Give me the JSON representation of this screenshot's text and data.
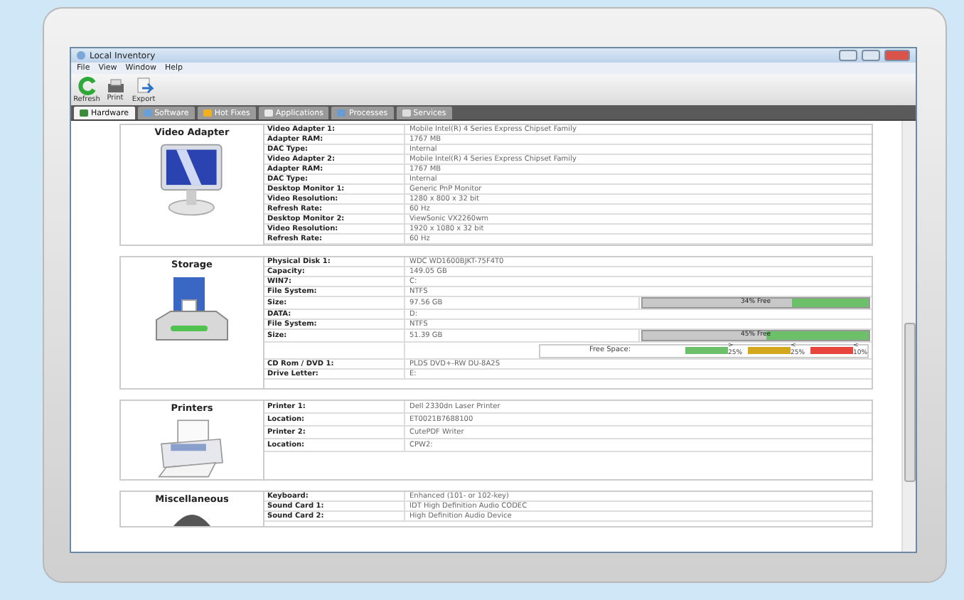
{
  "window": {
    "title": "Local Inventory"
  },
  "menu": [
    "File",
    "View",
    "Window",
    "Help"
  ],
  "toolbar": [
    {
      "label": "Refresh",
      "kind": "refresh"
    },
    {
      "label": "Print",
      "kind": "print"
    },
    {
      "label": "Export",
      "kind": "export"
    }
  ],
  "tabs": [
    {
      "label": "Hardware",
      "selected": true
    },
    {
      "label": "Software",
      "selected": false
    },
    {
      "label": "Hot Fixes",
      "selected": false
    },
    {
      "label": "Applications",
      "selected": false
    },
    {
      "label": "Processes",
      "selected": false
    },
    {
      "label": "Services",
      "selected": false
    }
  ],
  "sections": [
    {
      "title": "Video Adapter",
      "kind": "video",
      "rows": [
        {
          "label": "Video Adapter 1:",
          "value": "Mobile Intel(R) 4 Series Express Chipset Family"
        },
        {
          "label": "Adapter RAM:",
          "value": "1767 MB"
        },
        {
          "label": "DAC Type:",
          "value": "Internal"
        },
        {
          "label": "Video Adapter 2:",
          "value": "Mobile Intel(R) 4 Series Express Chipset Family"
        },
        {
          "label": "Adapter RAM:",
          "value": "1767 MB"
        },
        {
          "label": "DAC Type:",
          "value": "Internal"
        },
        {
          "label": "Desktop Monitor 1:",
          "value": "Generic PnP Monitor"
        },
        {
          "label": "Video Resolution:",
          "value": "1280 x 800 x 32 bit"
        },
        {
          "label": "Refresh Rate:",
          "value": "60 Hz"
        },
        {
          "label": "Desktop Monitor 2:",
          "value": "ViewSonic VX2260wm"
        },
        {
          "label": "Video Resolution:",
          "value": "1920 x 1080 x 32 bit"
        },
        {
          "label": "Refresh Rate:",
          "value": "60 Hz"
        }
      ]
    },
    {
      "title": "Storage",
      "kind": "storage",
      "rows": [
        {
          "label": "Physical Disk 1:",
          "value": "WDC WD1600BJKT-75F4T0"
        },
        {
          "label": "Capacity:",
          "value": "149.05 GB"
        },
        {
          "label": "WIN7:",
          "value": "C:"
        },
        {
          "label": "File System:",
          "value": "NTFS"
        },
        {
          "label": "Size:",
          "value": "97.56 GB",
          "bar": {
            "level": 0.34,
            "text": "34% Free"
          }
        },
        {
          "label": "DATA:",
          "value": "D:"
        },
        {
          "label": "File System:",
          "value": "NTFS"
        },
        {
          "label": "Size:",
          "value": "51.39 GB",
          "bar": {
            "level": 0.45,
            "text": "45% Free"
          }
        },
        {
          "legend": {
            "label": "Free Space:",
            "items": [
              {
                "text": "> 25%",
                "color": "#6cc06a"
              },
              {
                "text": "< 25%",
                "color": "#d4a81c"
              },
              {
                "text": "< 10%",
                "color": "#e8463c"
              }
            ]
          }
        },
        {
          "label": "CD Rom / DVD 1:",
          "value": "PLDS DVD+-RW DU-8A2S"
        },
        {
          "label": "Drive Letter:",
          "value": "E:"
        }
      ]
    },
    {
      "title": "Printers",
      "kind": "printer",
      "rows": [
        {
          "label": "Printer 1:",
          "value": "Dell 2330dn Laser Printer"
        },
        {
          "label": "Location:",
          "value": "ET0021B7688100"
        },
        {
          "label": "Printer 2:",
          "value": "CutePDF Writer"
        },
        {
          "label": "Location:",
          "value": "CPW2:"
        }
      ]
    },
    {
      "title": "Miscellaneous",
      "kind": "misc",
      "rows": [
        {
          "label": "Keyboard:",
          "value": "Enhanced (101- or 102-key)"
        },
        {
          "label": "Sound Card 1:",
          "value": "IDT High Definition Audio CODEC"
        },
        {
          "label": "Sound Card 2:",
          "value": "High Definition Audio Device"
        }
      ]
    }
  ]
}
